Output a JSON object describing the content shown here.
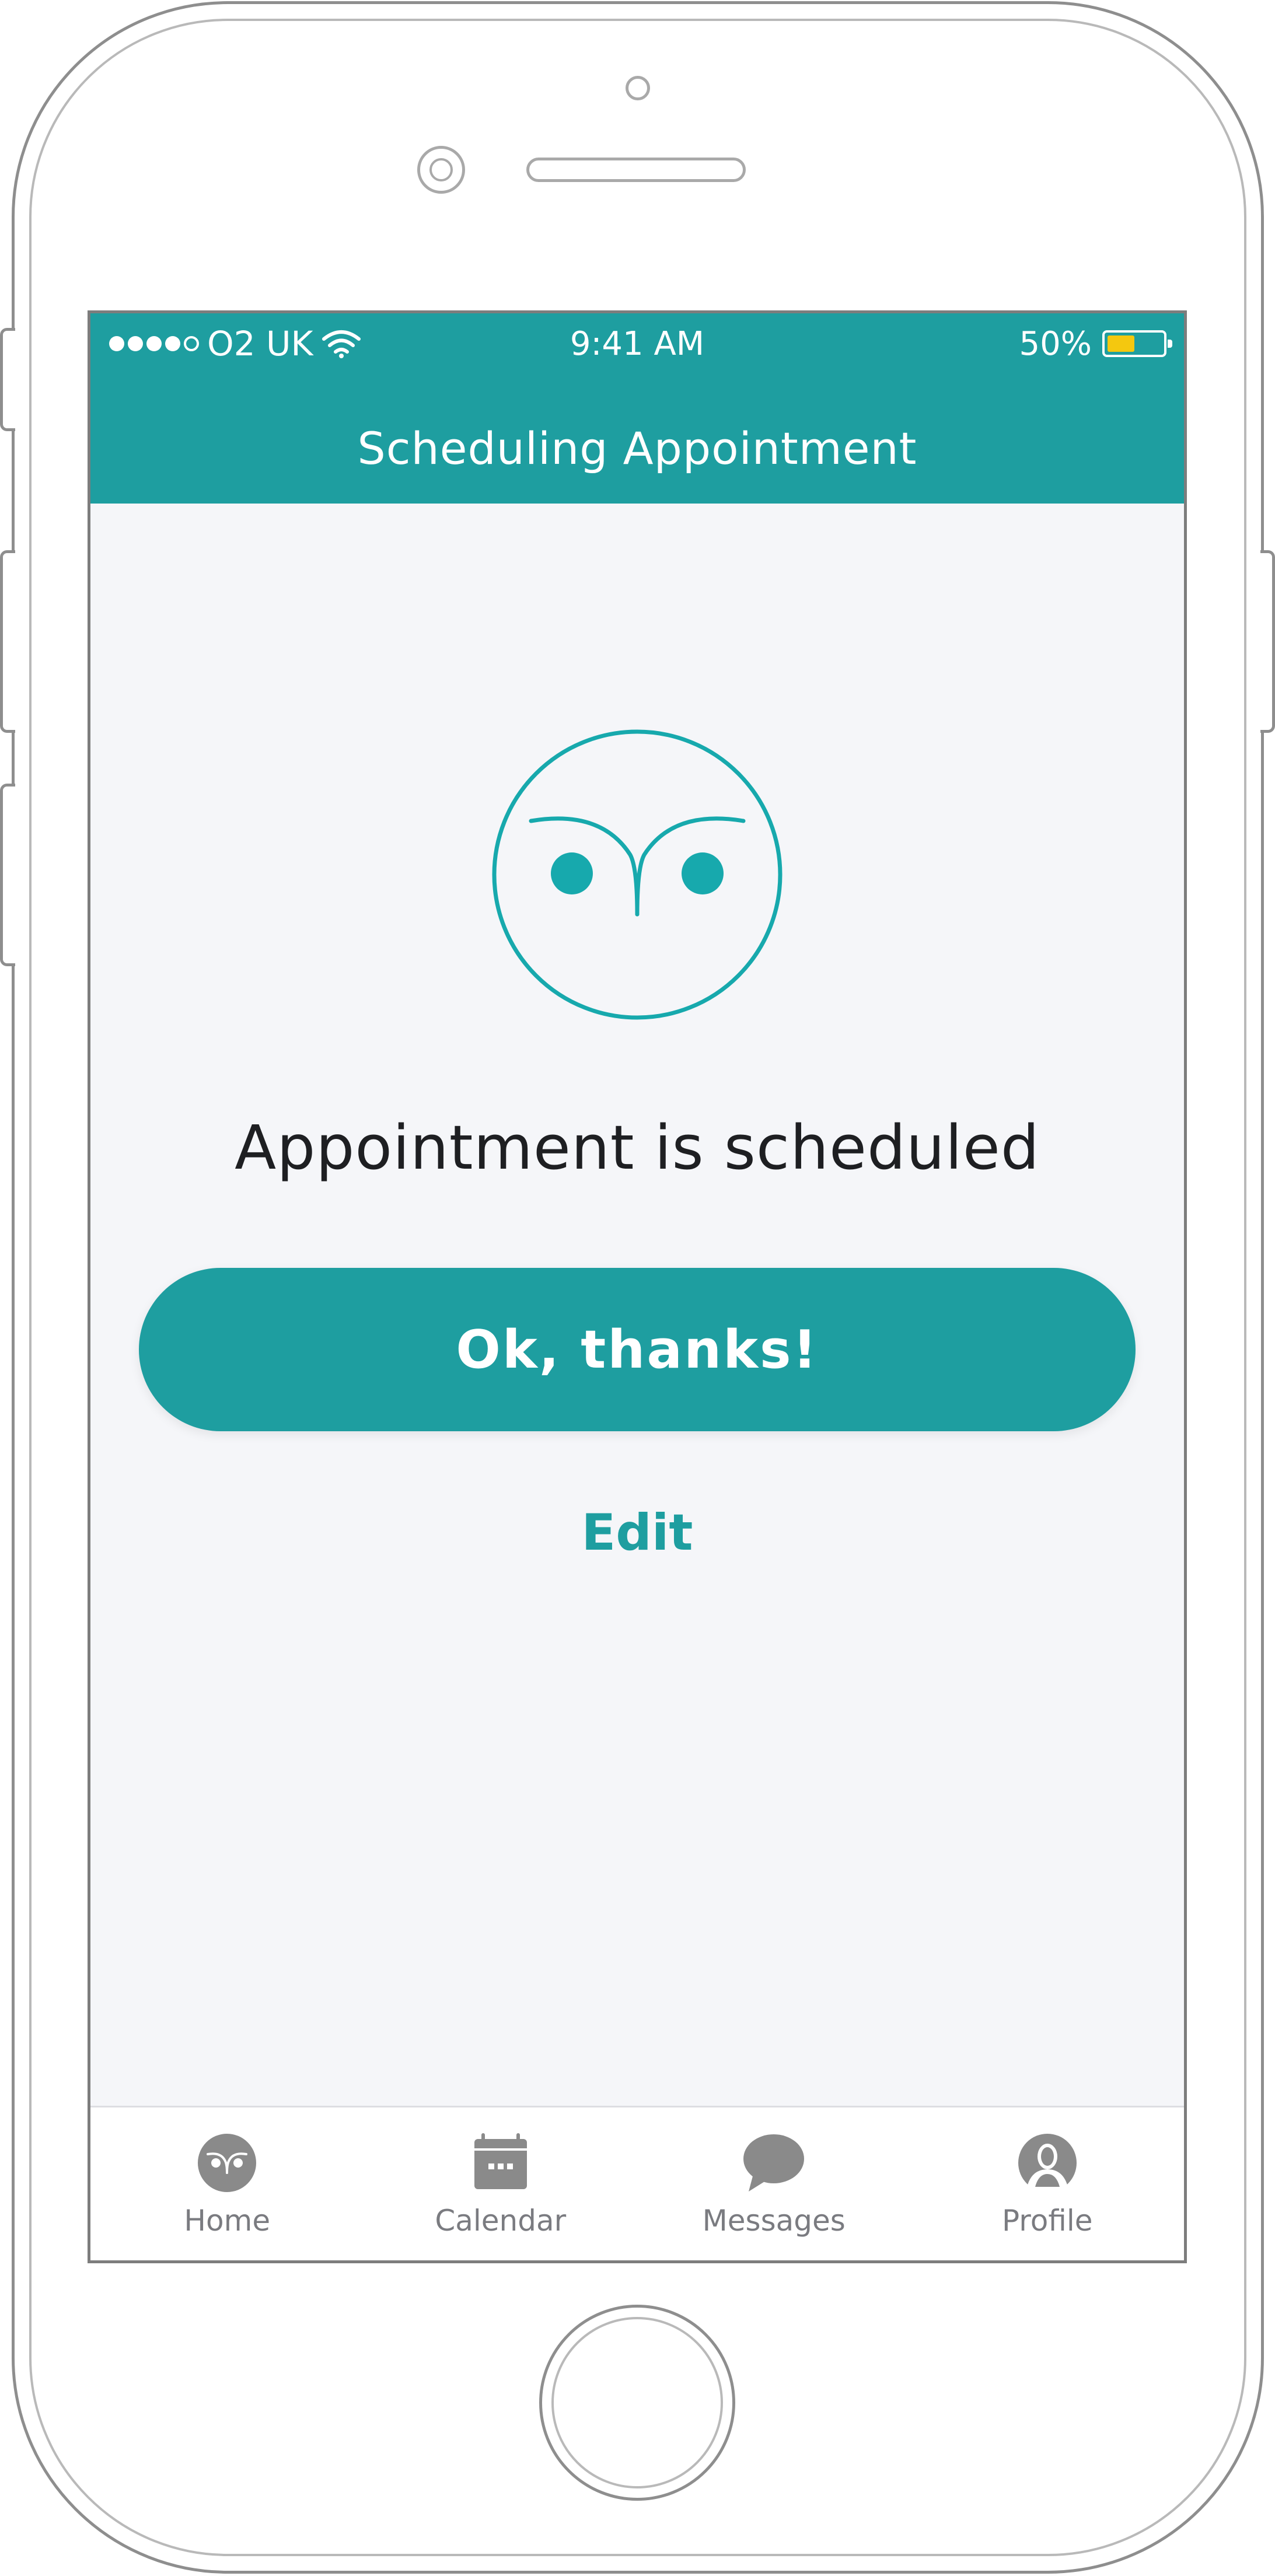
{
  "status_bar": {
    "carrier": "O2 UK",
    "signal_bars_filled": 4,
    "signal_bars_total": 5,
    "time": "9:41 AM",
    "battery_text": "50%",
    "battery_level": 0.5
  },
  "header": {
    "title": "Scheduling Appointment"
  },
  "main": {
    "icon": "owl-icon",
    "message": "Appointment is scheduled",
    "primary_button_label": "Ok, thanks!",
    "edit_link_label": "Edit"
  },
  "tab_bar": {
    "items": [
      {
        "label": "Home",
        "icon": "owl-icon"
      },
      {
        "label": "Calendar",
        "icon": "calendar-icon"
      },
      {
        "label": "Messages",
        "icon": "chat-bubble-icon"
      },
      {
        "label": "Profile",
        "icon": "person-icon"
      }
    ]
  },
  "colors": {
    "brand": "#1e9ea0",
    "icon_teal": "#17a9ad",
    "background": "#f5f6f9",
    "battery": "#f4c80f",
    "tab_icon": "#8a8a8a"
  }
}
